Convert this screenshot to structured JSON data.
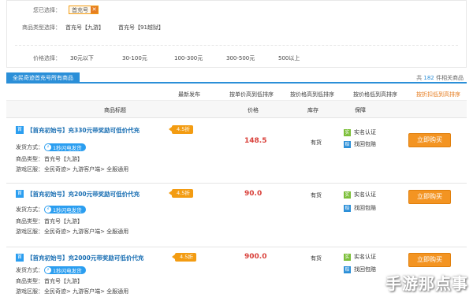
{
  "filters": {
    "selected_label": "您已选择：",
    "selected_chip": "首充号",
    "chip_close": "✕",
    "type_label": "商品类型选择：",
    "type_options": [
      "首充号【九游】",
      "首充号【91越狱】"
    ],
    "price_label": "价格选择：",
    "price_options": [
      "30元以下",
      "30-100元",
      "100-300元",
      "300-500元",
      "500以上"
    ]
  },
  "tabbar": {
    "tab": "全民奇迹首充号所有商品",
    "count_prefix": "共",
    "count": "182",
    "count_suffix": "件相关商品"
  },
  "sort": [
    "最新发布",
    "按单价高到低排序",
    "按价格高到低排序",
    "按价格低到高排序",
    "按折扣低到高排序"
  ],
  "columns": {
    "title": "商品标题",
    "price": "价格",
    "stock": "库存",
    "guarantee": "保障"
  },
  "labels": {
    "ship": "发货方式：",
    "type": "商品类型：",
    "region": "游戏区服：",
    "ship_badge": "1秒闪电发货",
    "guar1": "实名认证",
    "guar2": "找回包赔",
    "buy": "立即购买",
    "first_badge": "首"
  },
  "items": [
    {
      "title": "【首充初始号】充330元带奖励可低价代充",
      "discount": "4.5折",
      "type": "首充号【九游】",
      "region": "全民奇迹> 九游客户端> 全服通用",
      "price": "148.5",
      "stock": "有货"
    },
    {
      "title": "【首充初始号】充200元带奖励可低价代充",
      "discount": "4.5折",
      "type": "首充号【九游】",
      "region": "全民奇迹> 九游客户端> 全服通用",
      "price": "90.0",
      "stock": "有货"
    },
    {
      "title": "【首充初始号】充2000元带奖励可低价代充",
      "discount": "4.5折",
      "type": "首充号【九游】",
      "region": "全民奇迹> 九游客户端> 全服通用",
      "price": "900.0",
      "stock": "有货"
    }
  ],
  "watermark": "手游那点事",
  "colors": {
    "accent": "#2b8fd8",
    "orange": "#f39422",
    "price": "#d9403a"
  }
}
